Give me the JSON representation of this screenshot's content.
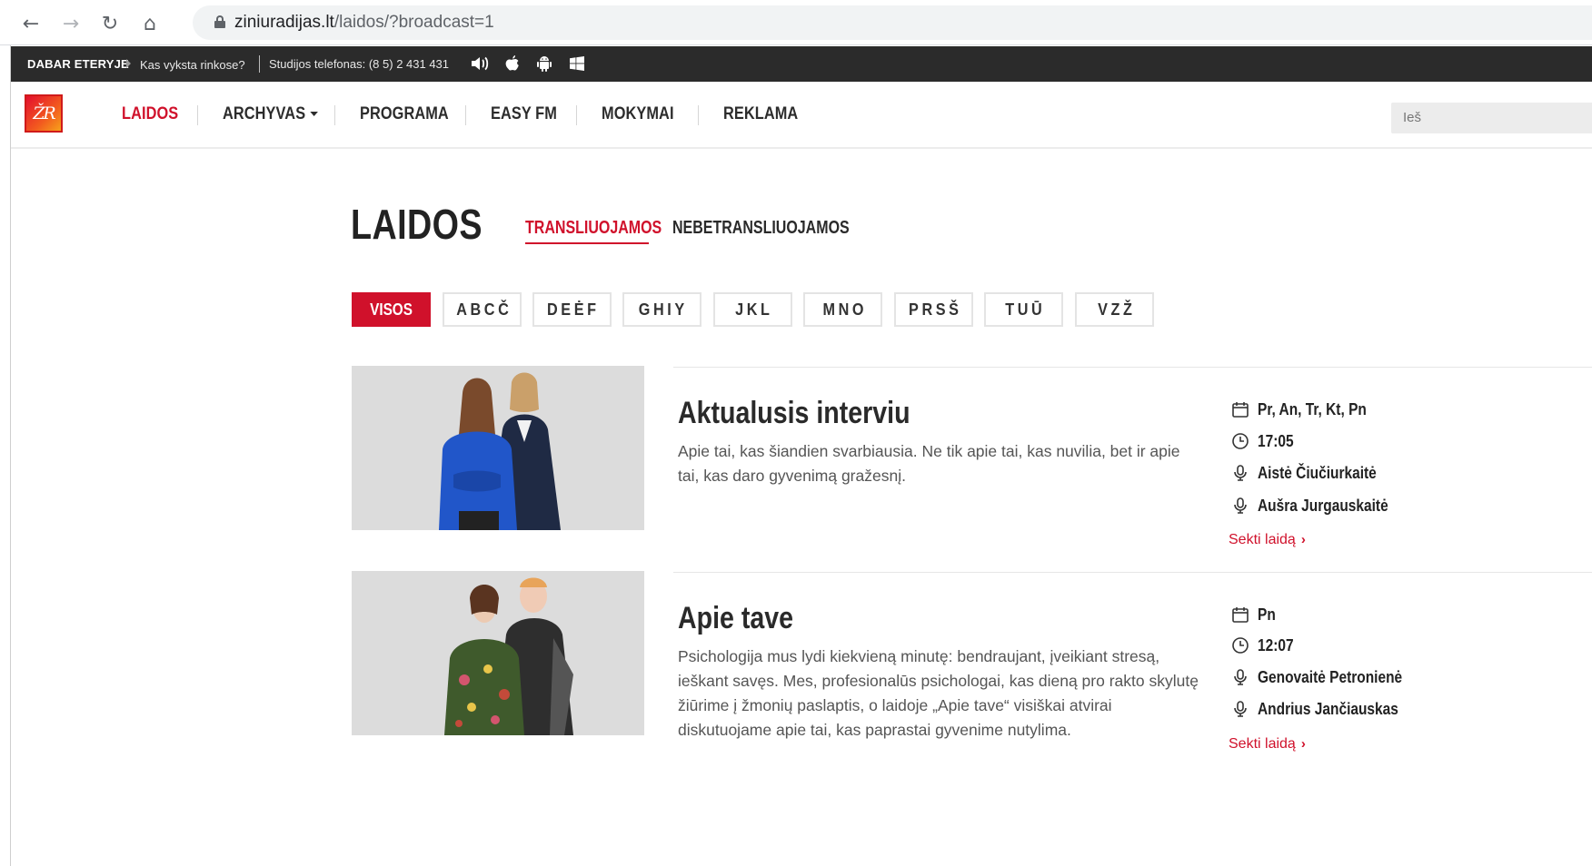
{
  "browser": {
    "url_domain": "ziniuradijas.lt",
    "url_path": "/laidos/?broadcast=1",
    "back_glyph": "←",
    "forward_glyph": "→",
    "reload_glyph": "↻",
    "home_glyph": "⌂"
  },
  "topbar": {
    "on_air_label": "DABAR ETERYJE",
    "now_playing": "Kas vyksta rinkose?",
    "studio_phone": "Studijos telefonas: (8 5) 2 431 431",
    "icons": [
      "speaker-icon",
      "apple-icon",
      "android-icon",
      "windows-icon"
    ]
  },
  "header": {
    "logo_text": "ŽR",
    "menu": [
      {
        "label": "LAIDOS",
        "active": true
      },
      {
        "label": "ARCHYVAS",
        "dropdown": true
      },
      {
        "label": "PROGRAMA"
      },
      {
        "label": "EASY FM"
      },
      {
        "label": "MOKYMAI"
      },
      {
        "label": "REKLAMA"
      }
    ],
    "search_partial": "Ieš"
  },
  "page": {
    "title": "LAIDOS",
    "tabs": [
      {
        "label": "TRANSLIUOJAMOS",
        "active": true
      },
      {
        "label": "NEBETRANSLIUOJAMOS"
      }
    ],
    "filters": [
      "VISOS",
      "ABCČ",
      "DEĖF",
      "GHIY",
      "JKL",
      "MNO",
      "PRSŠ",
      "TUŪ",
      "VZŽ"
    ],
    "active_filter": "VISOS"
  },
  "shows": [
    {
      "title": "Aktualusis interviu",
      "description": "Apie tai, kas šiandien svarbiausia. Ne tik apie tai, kas nuvilia, bet ir apie tai, kas daro gyvenimą gražesnį.",
      "days": "Pr, An, Tr, Kt, Pn",
      "time": "17:05",
      "hosts": [
        "Aistė Čiučiurkaitė",
        "Aušra Jurgauskaitė"
      ],
      "follow_label": "Sekti laidą"
    },
    {
      "title": "Apie tave",
      "description": "Psichologija mus lydi kiekvieną minutę: bendraujant, įveikiant stresą, ieškant savęs. Mes, profesionalūs psichologai, kas dieną pro rakto skylutę žiūrime į žmonių paslaptis, o laidoje „Apie tave“ visiškai atvirai diskutuojame apie tai, kas paprastai gyvenime nutylima.",
      "days": "Pn",
      "time": "12:07",
      "hosts": [
        "Genovaitė Petronienė",
        "Andrius Jančiauskas"
      ],
      "follow_label": "Sekti laidą"
    }
  ],
  "colors": {
    "brand_red": "#d0112b",
    "topbar_bg": "#2b2b2b",
    "text_dark": "#222222"
  }
}
